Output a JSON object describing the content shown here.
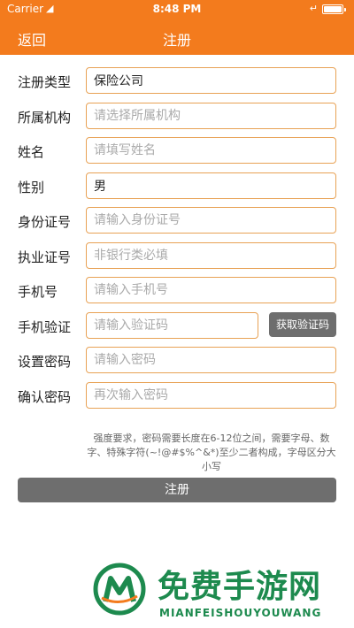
{
  "status_bar": {
    "carrier": "Carrier",
    "wifi_icon": "wifi-icon",
    "time": "8:48 PM",
    "battery_icon": "battery-icon"
  },
  "nav": {
    "back_label": "返回",
    "title": "注册"
  },
  "form": {
    "rows": [
      {
        "label": "注册类型",
        "value": "保险公司",
        "placeholder": ""
      },
      {
        "label": "所属机构",
        "value": "",
        "placeholder": "请选择所属机构"
      },
      {
        "label": "姓名",
        "value": "",
        "placeholder": "请填写姓名"
      },
      {
        "label": "性别",
        "value": "男",
        "placeholder": ""
      },
      {
        "label": "身份证号",
        "value": "",
        "placeholder": "请输入身份证号"
      },
      {
        "label": "执业证号",
        "value": "",
        "placeholder": "非银行类必填"
      },
      {
        "label": "手机号",
        "value": "",
        "placeholder": "请输入手机号"
      },
      {
        "label": "手机验证",
        "value": "",
        "placeholder": "请输入验证码"
      },
      {
        "label": "设置密码",
        "value": "",
        "placeholder": "请输入密码"
      },
      {
        "label": "确认密码",
        "value": "",
        "placeholder": "再次输入密码"
      }
    ],
    "get_code_label": "获取验证码"
  },
  "hint": "强度要求，密码需要长度在6-12位之间，需要字母、数字、特殊字符(~!@#$%^&*)至少二者构成，字母区分大小写",
  "submit_label": "注册",
  "watermark": {
    "title": "免费手游网",
    "subtitle": "MIANFEISHOUYOUWANG"
  },
  "colors": {
    "accent": "#f37b1d",
    "border": "#e8a255",
    "button": "#6e6e6e",
    "watermark": "#1d8a4e"
  }
}
